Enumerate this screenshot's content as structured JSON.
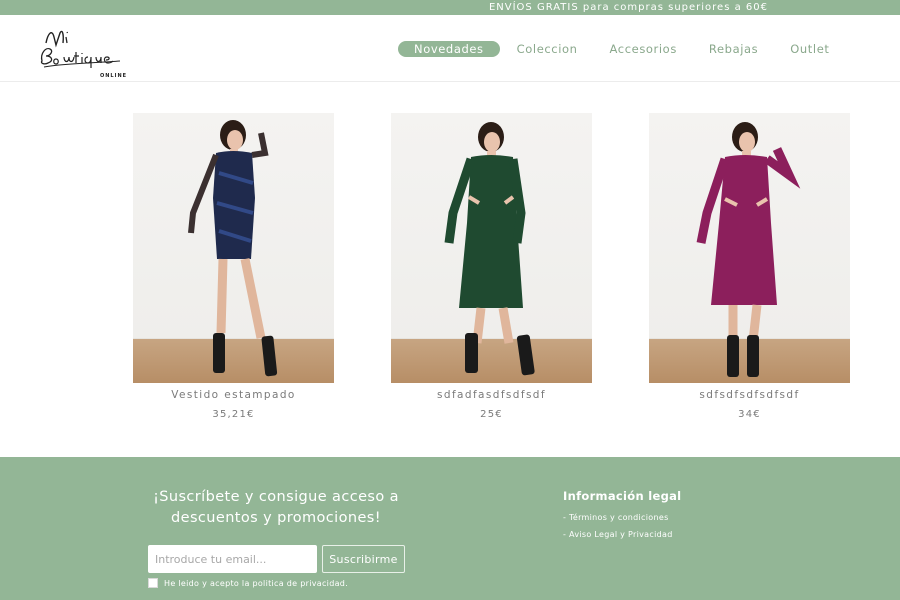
{
  "announcement": "ENVÍOS GRATIS para compras superiores a 60€",
  "brand": {
    "logo_script": "Mi Boutique",
    "logo_tagline": "ONLINE"
  },
  "nav": {
    "items": [
      {
        "label": "Novedades",
        "active": true
      },
      {
        "label": "Coleccion",
        "active": false
      },
      {
        "label": "Accesorios",
        "active": false
      },
      {
        "label": "Rebajas",
        "active": false
      },
      {
        "label": "Outlet",
        "active": false
      }
    ]
  },
  "products": [
    {
      "name": "Vestido estampado",
      "price": "35,21€",
      "dress_color": "#1f2a4d"
    },
    {
      "name": "sdfadfasdfsdfsdf",
      "price": "25€",
      "dress_color": "#1f4a30"
    },
    {
      "name": "sdfsdfsdfsdfsdf",
      "price": "34€",
      "dress_color": "#8c1f5c"
    }
  ],
  "footer": {
    "subscribe_title": "¡Suscríbete y consigue acceso a descuentos y promociones!",
    "email_placeholder": "Introduce tu email...",
    "subscribe_button": "Suscribirme",
    "consent_label": "He leido y acepto la politica de privacidad.",
    "legal_title": "Información legal",
    "legal_links": [
      "- Términos y condiciones",
      "- Aviso Legal y Privacidad"
    ]
  },
  "colors": {
    "accent": "#93b696",
    "nav_text": "#8aa88c",
    "white": "#ffffff"
  }
}
